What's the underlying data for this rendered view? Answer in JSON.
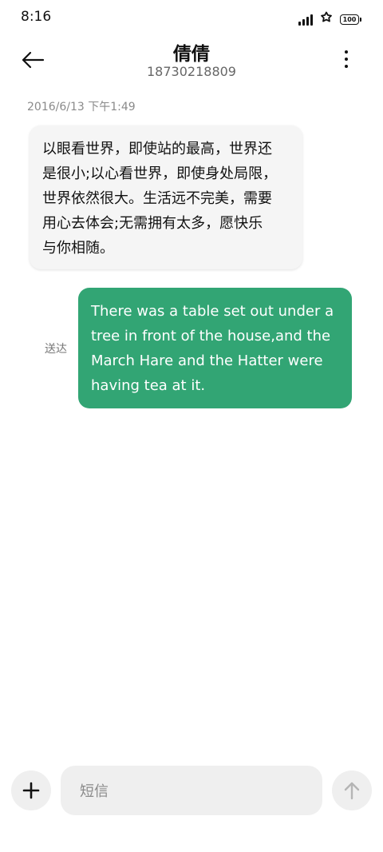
{
  "status_bar": {
    "time": "8:16",
    "battery": "100",
    "icons": [
      "signal-icon",
      "flower-icon",
      "battery-icon"
    ]
  },
  "header": {
    "contact_name": "倩倩",
    "contact_number": "18730218809",
    "back_icon": "back-arrow-icon",
    "more_icon": "more-vertical-icon"
  },
  "messages": [
    {
      "direction": "incoming",
      "timestamp": "2016/6/13 下午1:49",
      "lines": [
        "以眼看世界，即使站的最高，世界还",
        "是很小;以心看世界，即使身处局限，",
        "世界依然很大。生活远不完美，需要",
        "用心去体会;无需拥有太多，愿快乐",
        "与你相随。"
      ]
    },
    {
      "direction": "outgoing",
      "status": "送达",
      "lines": [
        "There was a table set out under a",
        "tree in front of the house,and the",
        "March Hare and the Hatter were",
        "having tea at it."
      ]
    }
  ],
  "composer": {
    "placeholder": "短信",
    "add_icon": "plus-icon",
    "send_icon": "send-arrow-up-icon"
  },
  "colors": {
    "outgoing_bubble": "#32a574",
    "incoming_bubble": "#f5f5f5",
    "composer_bg": "#efefef"
  }
}
